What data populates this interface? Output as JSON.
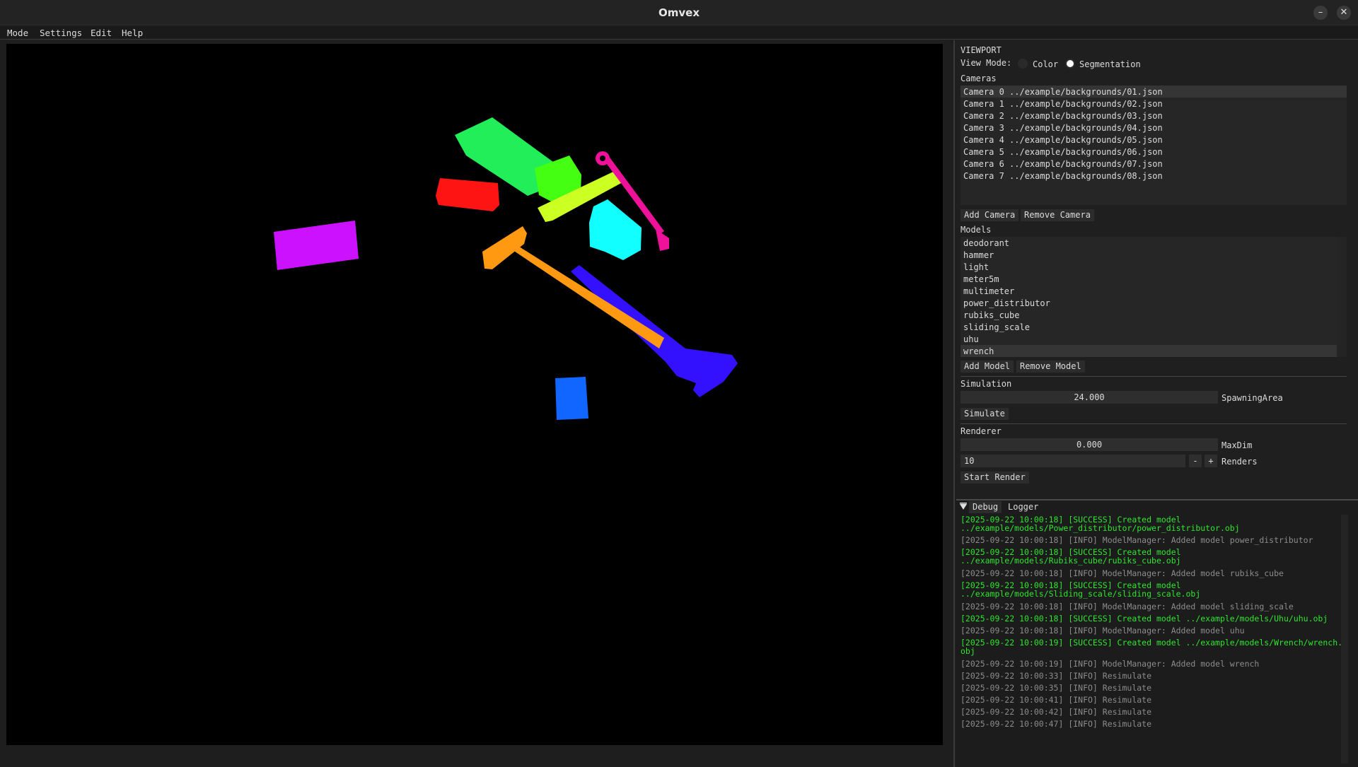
{
  "window": {
    "title": "Omvex",
    "minimize_glyph": "–",
    "close_glyph": "✕"
  },
  "menu": [
    "Mode",
    "Settings",
    "Edit",
    "Help"
  ],
  "viewport_panel": {
    "heading": "VIEWPORT",
    "view_mode_label": "View Mode:",
    "view_modes": [
      {
        "label": "Color",
        "selected": false
      },
      {
        "label": "Segmentation",
        "selected": true
      }
    ],
    "cameras_label": "Cameras",
    "cameras": [
      "Camera 0 ../example/backgrounds/01.json",
      "Camera 1 ../example/backgrounds/02.json",
      "Camera 2 ../example/backgrounds/03.json",
      "Camera 3 ../example/backgrounds/04.json",
      "Camera 4 ../example/backgrounds/05.json",
      "Camera 5 ../example/backgrounds/06.json",
      "Camera 6 ../example/backgrounds/07.json",
      "Camera 7 ../example/backgrounds/08.json"
    ],
    "selected_camera": 0,
    "add_camera": "Add Camera",
    "remove_camera": "Remove Camera",
    "models_label": "Models",
    "models": [
      "deodorant",
      "hammer",
      "light",
      "meter5m",
      "multimeter",
      "power_distributor",
      "rubiks_cube",
      "sliding_scale",
      "uhu",
      "wrench"
    ],
    "selected_model": 9,
    "add_model": "Add Model",
    "remove_model": "Remove Model"
  },
  "simulation": {
    "heading": "Simulation",
    "spawning_area_value": "24.000",
    "spawning_area_label": "SpawningArea",
    "simulate_button": "Simulate"
  },
  "renderer": {
    "heading": "Renderer",
    "maxdim_value": "0.000",
    "maxdim_label": "MaxDim",
    "renders_value": "10",
    "minus": "-",
    "plus": "+",
    "renders_label": "Renders",
    "start_button": "Start Render"
  },
  "logger": {
    "tab_debug": "Debug",
    "tab_logger": "Logger",
    "lines": [
      {
        "text": "[2025-09-22 10:00:18] [SUCCESS] Created model",
        "level": "ok"
      },
      {
        "text": "../example/models/Power_distributor/power_distributor.obj",
        "level": "ok"
      },
      {
        "text": "[2025-09-22 10:00:18] [INFO] ModelManager: Added model power_distributor",
        "level": "info"
      },
      {
        "text": "[2025-09-22 10:00:18] [SUCCESS] Created model",
        "level": "ok"
      },
      {
        "text": "../example/models/Rubiks_cube/rubiks_cube.obj",
        "level": "ok"
      },
      {
        "text": "[2025-09-22 10:00:18] [INFO] ModelManager: Added model rubiks_cube",
        "level": "info"
      },
      {
        "text": "[2025-09-22 10:00:18] [SUCCESS] Created model",
        "level": "ok"
      },
      {
        "text": "../example/models/Sliding_scale/sliding_scale.obj",
        "level": "ok"
      },
      {
        "text": "[2025-09-22 10:00:18] [INFO] ModelManager: Added model sliding_scale",
        "level": "info"
      },
      {
        "text": "[2025-09-22 10:00:18] [SUCCESS] Created model ../example/models/Uhu/uhu.obj",
        "level": "ok"
      },
      {
        "text": "[2025-09-22 10:00:18] [INFO] ModelManager: Added model uhu",
        "level": "info"
      },
      {
        "text": "[2025-09-22 10:00:19] [SUCCESS] Created model ../example/models/Wrench/wrench.",
        "level": "ok"
      },
      {
        "text": "obj",
        "level": "ok"
      },
      {
        "text": "[2025-09-22 10:00:19] [INFO] ModelManager: Added model wrench",
        "level": "info"
      },
      {
        "text": "[2025-09-22 10:00:33] [INFO] Resimulate",
        "level": "info"
      },
      {
        "text": "[2025-09-22 10:00:35] [INFO] Resimulate",
        "level": "info"
      },
      {
        "text": "[2025-09-22 10:00:41] [INFO] Resimulate",
        "level": "info"
      },
      {
        "text": "[2025-09-22 10:00:42] [INFO] Resimulate",
        "level": "info"
      },
      {
        "text": "[2025-09-22 10:00:47] [INFO] Resimulate",
        "level": "info"
      }
    ]
  },
  "scene_colors": {
    "green_deodorant": "#22ee5a",
    "lime_block": "#44ff11",
    "yellow_bar": "#ccff22",
    "red_block": "#ff1414",
    "magenta_wrench": "#ee1199",
    "cyan_object": "#11ffff",
    "purple_box": "#cc11ff",
    "orange_hammer": "#ff9911",
    "blue_scale": "#3311ff",
    "blue_cube": "#1166ff"
  }
}
